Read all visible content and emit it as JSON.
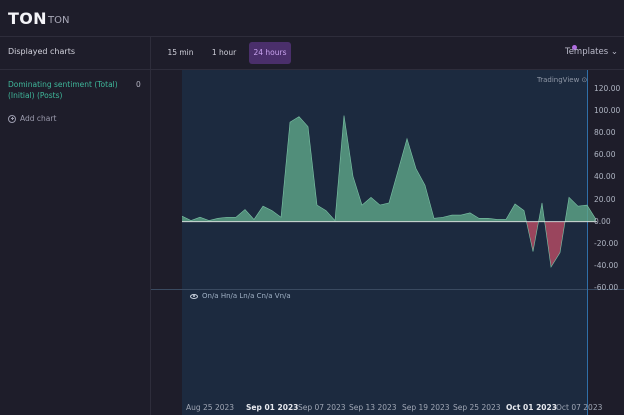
{
  "header": {
    "title": "TON",
    "subtitle": "TON"
  },
  "sidebar": {
    "heading": "Displayed charts",
    "items": [
      {
        "label": "Dominating sentiment (Total) (Initial) (Posts)",
        "count": "0"
      }
    ],
    "add_label": "Add chart"
  },
  "toolbar": {
    "timeframes": [
      {
        "label": "15 min",
        "active": false
      },
      {
        "label": "1 hour",
        "active": false
      },
      {
        "label": "24 hours",
        "active": true
      }
    ],
    "templates_label": "Templates"
  },
  "chart": {
    "watermark": "TradingView",
    "pane2_legend": "On/a Hn/a Ln/a Cn/a Vn/a"
  },
  "colors": {
    "positive_fill": "#5fa88a",
    "negative_fill": "#b04a63",
    "pane_bg": "#1c2a3f",
    "accent": "#4a2f6b"
  },
  "chart_data": {
    "type": "area",
    "title": "",
    "ylabel": "",
    "ylim": [
      -60,
      120
    ],
    "y_ticks": [
      "120.00",
      "100.00",
      "80.00",
      "60.00",
      "40.00",
      "20.00",
      "0.00",
      "-20.00",
      "-40.00",
      "-60.00"
    ],
    "x_tick_labels": [
      {
        "label": "Aug 25 2023",
        "bold": false
      },
      {
        "label": "Sep 01 2023",
        "bold": true
      },
      {
        "label": "Sep 07 2023",
        "bold": false
      },
      {
        "label": "Sep 13 2023",
        "bold": false
      },
      {
        "label": "Sep 19 2023",
        "bold": false
      },
      {
        "label": "Sep 25 2023",
        "bold": false
      },
      {
        "label": "Oct 01 2023",
        "bold": true
      },
      {
        "label": "Oct 07 2023",
        "bold": false
      }
    ],
    "series": [
      {
        "values": [
          5,
          1,
          4,
          1,
          3,
          4,
          4,
          11,
          2,
          14,
          10,
          4,
          90,
          95,
          86,
          15,
          10,
          1,
          96,
          41,
          15,
          22,
          15,
          17,
          46,
          75,
          48,
          33,
          3,
          4,
          6,
          6,
          8,
          3,
          3,
          2,
          2,
          16,
          10,
          -27,
          17,
          -41,
          -28,
          22,
          14,
          15,
          2
        ]
      }
    ]
  }
}
